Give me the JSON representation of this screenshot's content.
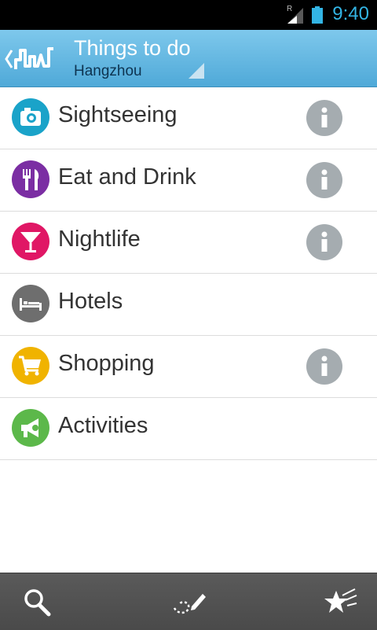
{
  "status_bar": {
    "time": "9:40",
    "roaming_indicator": "R",
    "icons": [
      "signal-icon",
      "battery-icon"
    ],
    "time_color": "#33b5e5"
  },
  "action_bar": {
    "title": "Things to do",
    "subtitle": "Hangzhou",
    "home_icon": "city-skyline-icon",
    "back_icon": "chevron-left-icon",
    "dropdown_icon": "dropdown-corner-icon"
  },
  "categories": [
    {
      "label": "Sightseeing",
      "icon": "camera-icon",
      "color": "#1aa3c9",
      "has_info": true
    },
    {
      "label": "Eat and Drink",
      "icon": "fork-knife-icon",
      "color": "#7b2ea3",
      "has_info": true
    },
    {
      "label": "Nightlife",
      "icon": "cocktail-icon",
      "color": "#e01765",
      "has_info": true
    },
    {
      "label": "Hotels",
      "icon": "bed-icon",
      "color": "#6e6e6e",
      "has_info": false
    },
    {
      "label": "Shopping",
      "icon": "shopping-cart-icon",
      "color": "#f0b300",
      "has_info": true
    },
    {
      "label": "Activities",
      "icon": "megaphone-icon",
      "color": "#5cb84a",
      "has_info": false
    }
  ],
  "bottom_bar": {
    "buttons": [
      "search-icon",
      "draw-route-icon",
      "favorites-star-icon"
    ]
  }
}
